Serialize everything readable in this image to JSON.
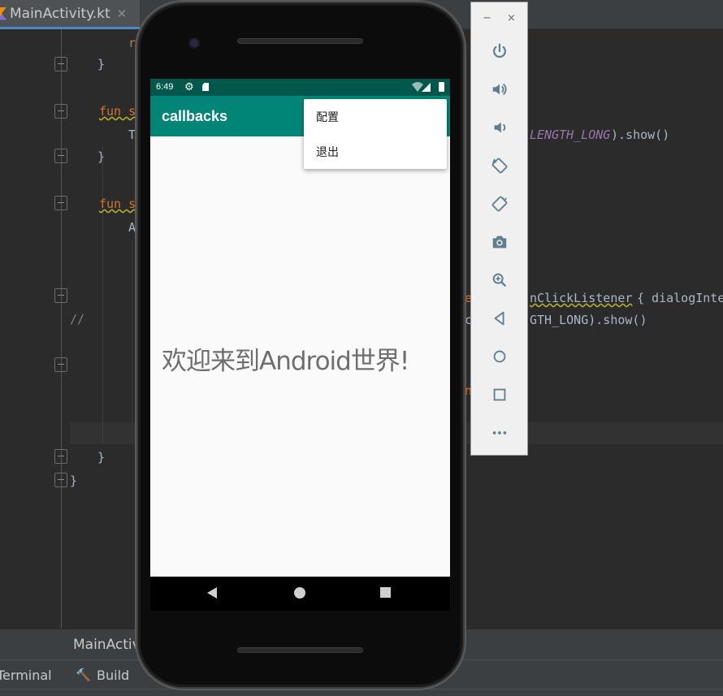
{
  "ide": {
    "tab": {
      "label": "MainActivity.kt",
      "close": "✕"
    },
    "code_lines": [
      {
        "t": "r",
        "cls": "kw"
      },
      {
        "t": "}",
        "cls": ""
      },
      {
        "t": "fun s",
        "cls": "kw"
      },
      {
        "t": "T",
        "cls": ""
      },
      {
        "t": "}",
        "cls": ""
      },
      {
        "t": "fun s",
        "cls": "kw"
      },
      {
        "t": "A",
        "cls": ""
      },
      {
        "t": "//",
        "cls": "cm"
      },
      {
        "t": "}",
        "cls": ""
      },
      {
        "t": "}",
        "cls": ""
      }
    ],
    "right_code": {
      "length_long": "LENGTH_LONG",
      "show1": ").show()",
      "click": "nClickListener",
      "dialog": "{ dialogInte",
      "gth": "GTH_LONG).show()",
      "e": "e",
      "c": "c",
      "n": "n"
    },
    "bottom_file": "MainActivi",
    "toolbar": {
      "terminal": "Terminal",
      "build": "Build",
      "build_icon": "hammer-icon"
    }
  },
  "phone": {
    "status": {
      "time": "6:49"
    },
    "app_title": "callbacks",
    "welcome_text": "欢迎来到Android世界!",
    "menu": {
      "items": [
        {
          "label": "配置"
        },
        {
          "label": "退出"
        }
      ]
    }
  },
  "emulator_toolbar": {
    "minimize": "−",
    "close": "×",
    "buttons": [
      {
        "name": "power-icon"
      },
      {
        "name": "volume-up-icon"
      },
      {
        "name": "volume-down-icon"
      },
      {
        "name": "rotate-left-icon"
      },
      {
        "name": "rotate-right-icon"
      },
      {
        "name": "camera-icon"
      },
      {
        "name": "zoom-icon"
      },
      {
        "name": "back-icon"
      },
      {
        "name": "home-icon"
      },
      {
        "name": "overview-icon"
      },
      {
        "name": "more-icon"
      }
    ]
  },
  "colors": {
    "status_bar": "#00574b",
    "app_bar": "#008577",
    "ide_bg": "#2b2b2b"
  }
}
